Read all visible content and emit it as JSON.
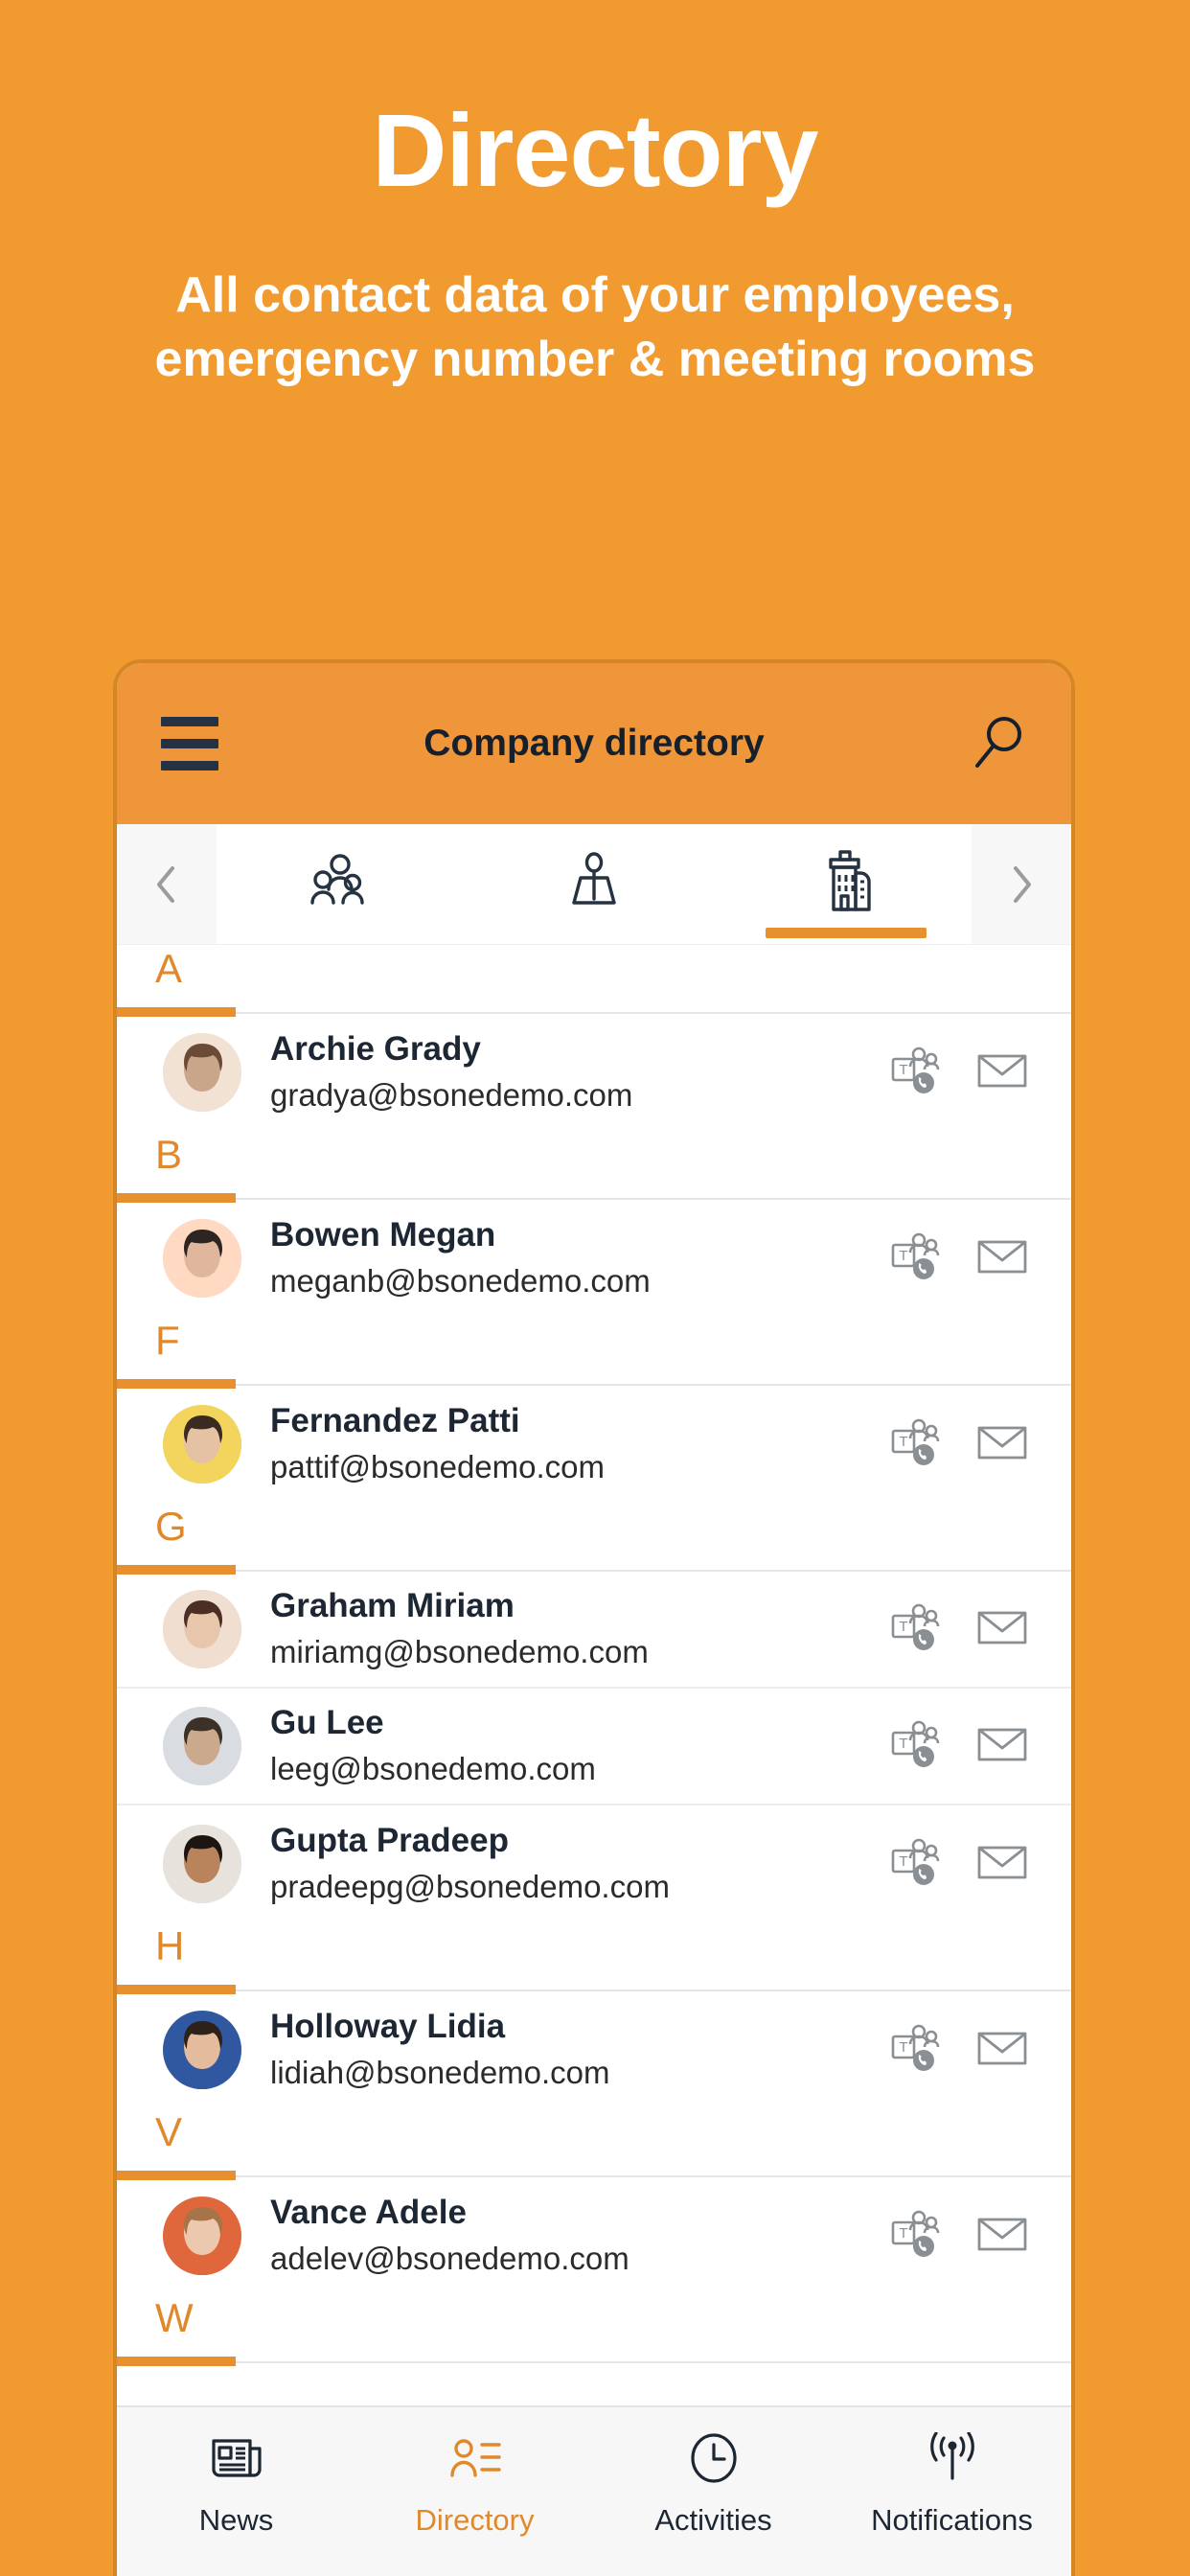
{
  "promo": {
    "title": "Directory",
    "subtitle": "All contact data of your employees, emergency number & meeting rooms"
  },
  "colors": {
    "brand_orange": "#F09A30",
    "header_orange": "#F0963A",
    "accent_orange": "#E7902F",
    "letter_orange": "#E0892C",
    "text_dark": "#1d2733",
    "divider": "#ececec"
  },
  "app": {
    "header": {
      "title": "Company directory",
      "menu_icon": "hamburger-menu-icon",
      "search_icon": "search-icon"
    },
    "tabs": {
      "prev_icon": "chevron-left-icon",
      "next_icon": "chevron-right-icon",
      "items": [
        {
          "icon": "people-group-icon",
          "label": "People",
          "active": false
        },
        {
          "icon": "org-chart-icon",
          "label": "Org chart",
          "active": false
        },
        {
          "icon": "building-company-icon",
          "label": "Company",
          "active": true
        }
      ]
    },
    "actions": {
      "teams_call_icon": "teams-call-icon",
      "email_icon": "envelope-icon"
    },
    "sections": [
      {
        "letter": "A",
        "contacts": [
          {
            "name": "Archie Grady",
            "email": "gradya@bsonedemo.com",
            "avatar": "male-smiling-photo"
          }
        ]
      },
      {
        "letter": "B",
        "contacts": [
          {
            "name": "Bowen Megan",
            "email": "meganb@bsonedemo.com",
            "avatar": "female-glasses-photo"
          }
        ]
      },
      {
        "letter": "F",
        "contacts": [
          {
            "name": "Fernandez Patti",
            "email": "pattif@bsonedemo.com",
            "avatar": "female-yellow-top-photo"
          }
        ]
      },
      {
        "letter": "G",
        "contacts": [
          {
            "name": "Graham Miriam",
            "email": "miriamg@bsonedemo.com",
            "avatar": "female-dark-hair-photo"
          },
          {
            "name": "Gu Lee",
            "email": "leeg@bsonedemo.com",
            "avatar": "male-light-shirt-photo"
          },
          {
            "name": "Gupta Pradeep",
            "email": "pradeepg@bsonedemo.com",
            "avatar": "male-dark-hair-photo"
          }
        ]
      },
      {
        "letter": "H",
        "contacts": [
          {
            "name": "Holloway Lidia",
            "email": "lidiah@bsonedemo.com",
            "avatar": "female-blue-top-photo"
          }
        ]
      },
      {
        "letter": "V",
        "contacts": [
          {
            "name": "Vance Adele",
            "email": "adelev@bsonedemo.com",
            "avatar": "female-blonde-photo"
          }
        ]
      },
      {
        "letter": "W",
        "contacts": []
      }
    ],
    "bottom_nav": [
      {
        "label": "News",
        "icon": "newspaper-icon",
        "active": false
      },
      {
        "label": "Directory",
        "icon": "contact-card-icon",
        "active": true
      },
      {
        "label": "Activities",
        "icon": "clock-icon",
        "active": false
      },
      {
        "label": "Notifications",
        "icon": "broadcast-icon",
        "active": false
      }
    ]
  }
}
